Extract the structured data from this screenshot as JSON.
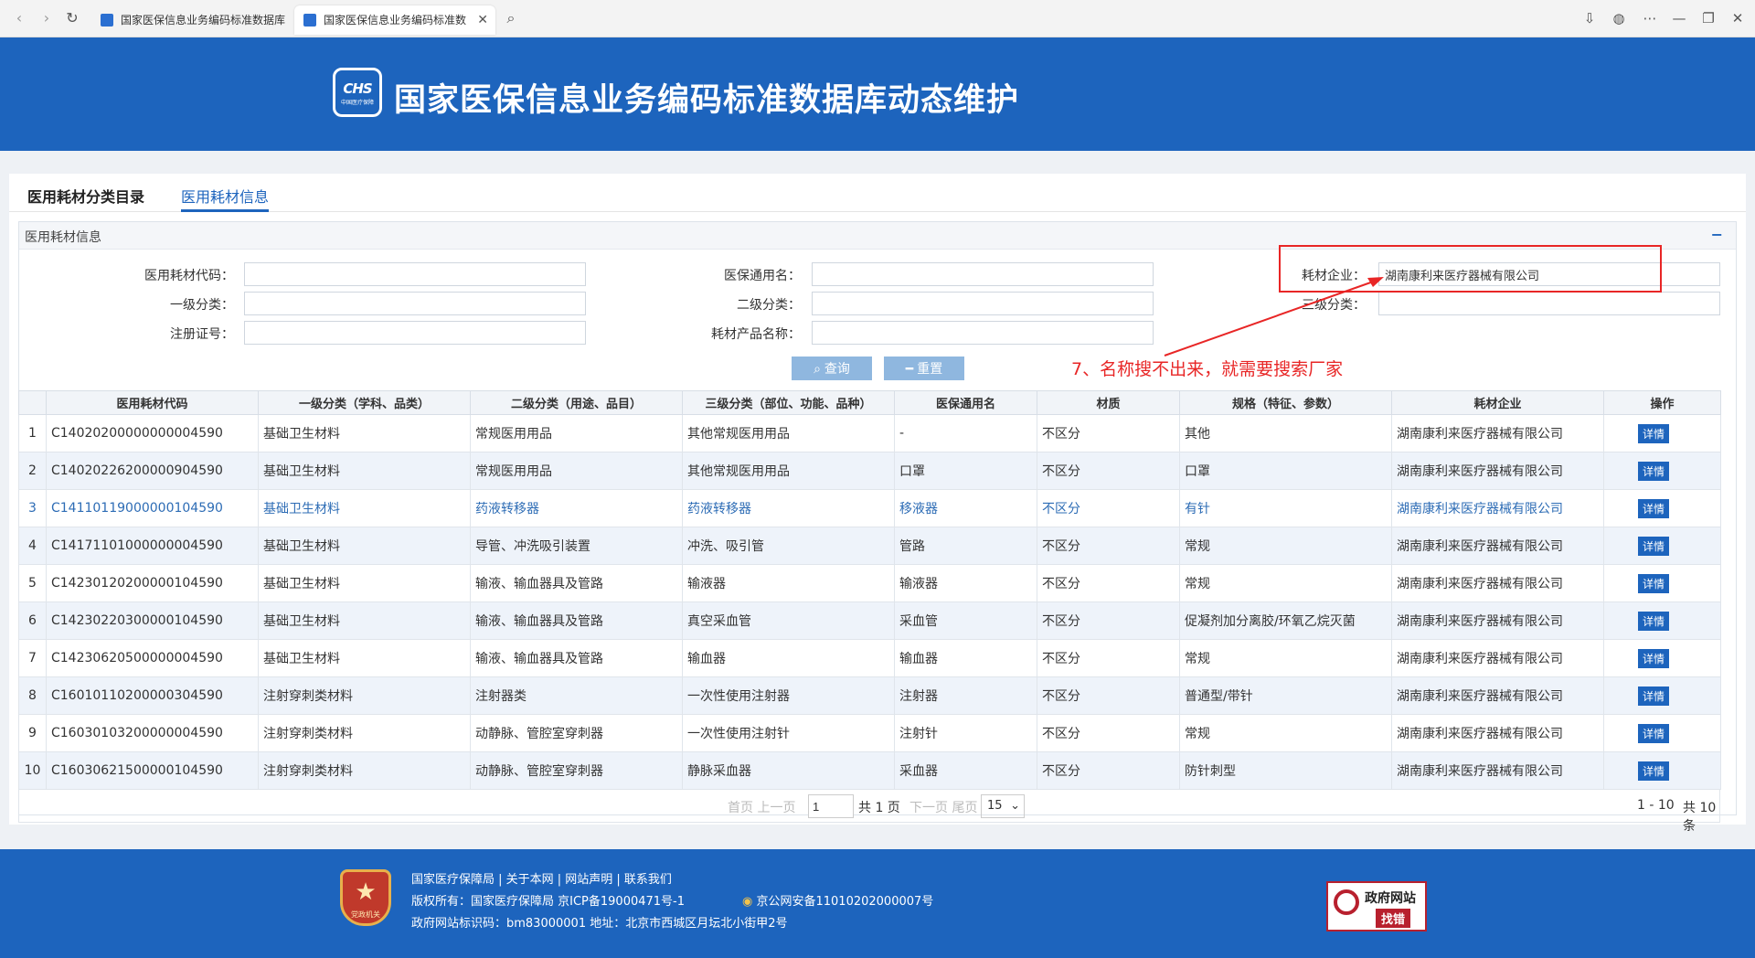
{
  "browser": {
    "tabs": [
      {
        "title": "国家医保信息业务编码标准数据库"
      },
      {
        "title": "国家医保信息业务编码标准数"
      }
    ],
    "colors": {
      "accent": "#1d64bd"
    }
  },
  "header": {
    "logo_text": "CHS",
    "logo_sub": "中国医疗保障",
    "title": "国家医保信息业务编码标准数据库动态维护"
  },
  "page_tabs": [
    {
      "label": "医用耗材分类目录"
    },
    {
      "label": "医用耗材信息"
    }
  ],
  "panel": {
    "title": "医用耗材信息",
    "collapse_icon": "−"
  },
  "form": {
    "code_label": "医用耗材代码：",
    "code_value": "",
    "generic_label": "医保通用名：",
    "generic_value": "",
    "company_label": "耗材企业：",
    "company_value": "湖南康利来医疗器械有限公司",
    "level1_label": "一级分类：",
    "level1_value": "",
    "level2_label": "二级分类：",
    "level2_value": "",
    "level3_label": "三级分类：",
    "level3_value": "",
    "reg_label": "注册证号：",
    "reg_value": "",
    "product_label": "耗材产品名称：",
    "product_value": ""
  },
  "buttons": {
    "query": "查询",
    "reset": "重置"
  },
  "annotation": {
    "text": "7、名称搜不出来，就需要搜索厂家",
    "color": "#e82626"
  },
  "table": {
    "columns": [
      "",
      "医用耗材代码",
      "一级分类（学科、品类）",
      "二级分类（用途、品目）",
      "三级分类（部位、功能、品种）",
      "医保通用名",
      "材质",
      "规格（特征、参数）",
      "耗材企业",
      "操作"
    ],
    "detail_label": "详情",
    "rows": [
      {
        "idx": "1",
        "code": "C14020200000000004590",
        "l1": "基础卫生材料",
        "l2": "常规医用用品",
        "l3": "其他常规医用用品",
        "generic": "-",
        "material": "不区分",
        "spec": "其他",
        "company": "湖南康利来医疗器械有限公司"
      },
      {
        "idx": "2",
        "code": "C14020226200000904590",
        "l1": "基础卫生材料",
        "l2": "常规医用用品",
        "l3": "其他常规医用用品",
        "generic": "口罩",
        "material": "不区分",
        "spec": "口罩",
        "company": "湖南康利来医疗器械有限公司"
      },
      {
        "idx": "3",
        "code": "C14110119000000104590",
        "l1": "基础卫生材料",
        "l2": "药液转移器",
        "l3": "药液转移器",
        "generic": "移液器",
        "material": "不区分",
        "spec": "有针",
        "company": "湖南康利来医疗器械有限公司"
      },
      {
        "idx": "4",
        "code": "C14171101000000004590",
        "l1": "基础卫生材料",
        "l2": "导管、冲洗吸引装置",
        "l3": "冲洗、吸引管",
        "generic": "管路",
        "material": "不区分",
        "spec": "常规",
        "company": "湖南康利来医疗器械有限公司"
      },
      {
        "idx": "5",
        "code": "C14230120200000104590",
        "l1": "基础卫生材料",
        "l2": "输液、输血器具及管路",
        "l3": "输液器",
        "generic": "输液器",
        "material": "不区分",
        "spec": "常规",
        "company": "湖南康利来医疗器械有限公司"
      },
      {
        "idx": "6",
        "code": "C14230220300000104590",
        "l1": "基础卫生材料",
        "l2": "输液、输血器具及管路",
        "l3": "真空采血管",
        "generic": "采血管",
        "material": "不区分",
        "spec": "促凝剂加分离胶/环氧乙烷灭菌",
        "company": "湖南康利来医疗器械有限公司"
      },
      {
        "idx": "7",
        "code": "C14230620500000004590",
        "l1": "基础卫生材料",
        "l2": "输液、输血器具及管路",
        "l3": "输血器",
        "generic": "输血器",
        "material": "不区分",
        "spec": "常规",
        "company": "湖南康利来医疗器械有限公司"
      },
      {
        "idx": "8",
        "code": "C16010110200000304590",
        "l1": "注射穿刺类材料",
        "l2": "注射器类",
        "l3": "一次性使用注射器",
        "generic": "注射器",
        "material": "不区分",
        "spec": "普通型/带针",
        "company": "湖南康利来医疗器械有限公司"
      },
      {
        "idx": "9",
        "code": "C16030103200000004590",
        "l1": "注射穿刺类材料",
        "l2": "动静脉、管腔室穿刺器",
        "l3": "一次性使用注射针",
        "generic": "注射针",
        "material": "不区分",
        "spec": "常规",
        "company": "湖南康利来医疗器械有限公司"
      },
      {
        "idx": "10",
        "code": "C16030621500000104590",
        "l1": "注射穿刺类材料",
        "l2": "动静脉、管腔室穿刺器",
        "l3": "静脉采血器",
        "generic": "采血器",
        "material": "不区分",
        "spec": "防针刺型",
        "company": "湖南康利来医疗器械有限公司"
      }
    ]
  },
  "pager": {
    "first_prev": "首页 上一页",
    "page_value": "1",
    "total_pages": "共 1 页",
    "next_last": "下一页 尾页",
    "page_size": "15",
    "range": "1 - 10",
    "total": "共 10 条"
  },
  "footer": {
    "emblem_tag": "党政机关",
    "links": "国家医疗保障局  |  关于本网  |  网站声明  |  联系我们",
    "copyright": "版权所有：国家医疗保障局    京ICP备19000471号-1",
    "police": "京公网安备11010202000007号",
    "site_id": "政府网站标识码：bm83000001    地址：北京市西城区月坛北小街甲2号",
    "gov_badge_top": "政府网站",
    "gov_badge_bottom": "找错"
  }
}
